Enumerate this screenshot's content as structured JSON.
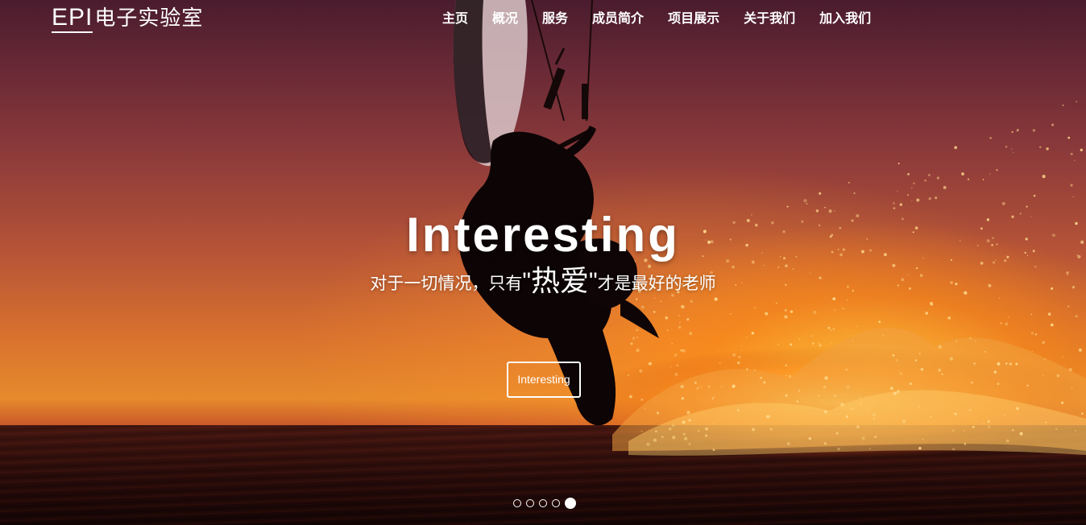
{
  "header": {
    "logo_mark": "EPI",
    "logo_text": "电子实验室",
    "nav": [
      {
        "label": "主页"
      },
      {
        "label": "概况"
      },
      {
        "label": "服务"
      },
      {
        "label": "成员简介"
      },
      {
        "label": "项目展示"
      },
      {
        "label": "关于我们"
      },
      {
        "label": "加入我们"
      }
    ]
  },
  "hero": {
    "title": "Interesting",
    "subtitle_before": "对于一切情况，只有",
    "quote_open": "\"",
    "subtitle_highlight": "热爱",
    "quote_close": "\"",
    "subtitle_after": "才是最好的老师",
    "button_label": "Interesting"
  },
  "carousel": {
    "slide_count": 5,
    "active_index": 4
  },
  "colors": {
    "text": "#ffffff",
    "sky_top": "#4a1c2e",
    "horizon_glow": "#e68a2c",
    "sea": "#2a0c0a"
  },
  "icons": {
    "carousel_indicator": "circle-dot-icon"
  }
}
